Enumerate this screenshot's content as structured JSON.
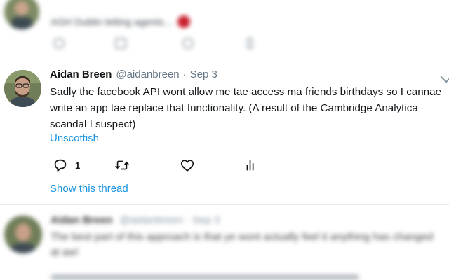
{
  "top_tweet": {
    "text": "AGH Dublin letting agents…"
  },
  "main_tweet": {
    "name": "Aidan Breen",
    "handle": "@aidanbreen",
    "separator": "·",
    "date": "Sep 3",
    "text": "Sadly the facebook API wont allow me tae access ma friends birthdays so I cannae write an app tae replace that functionality. (A result of the Cambridge Analytica scandal I suspect)",
    "translate_link": "Unscottish",
    "reply_count": "1",
    "show_thread": "Show this thread"
  },
  "bottom_tweet": {
    "name": "Aidan Breen",
    "handle": "@aidanbreen · Sep 3",
    "text": "The best part of this approach is that ye wont actually feel it anything has changed at aw!"
  },
  "icons": {
    "reply": "reply-icon",
    "retweet": "retweet-icon",
    "like": "like-icon",
    "analytics": "analytics-icon",
    "caret": "chevron-down-icon"
  },
  "colors": {
    "link": "#1b95e0",
    "secondary_text": "#657786",
    "icon": "#657786"
  }
}
